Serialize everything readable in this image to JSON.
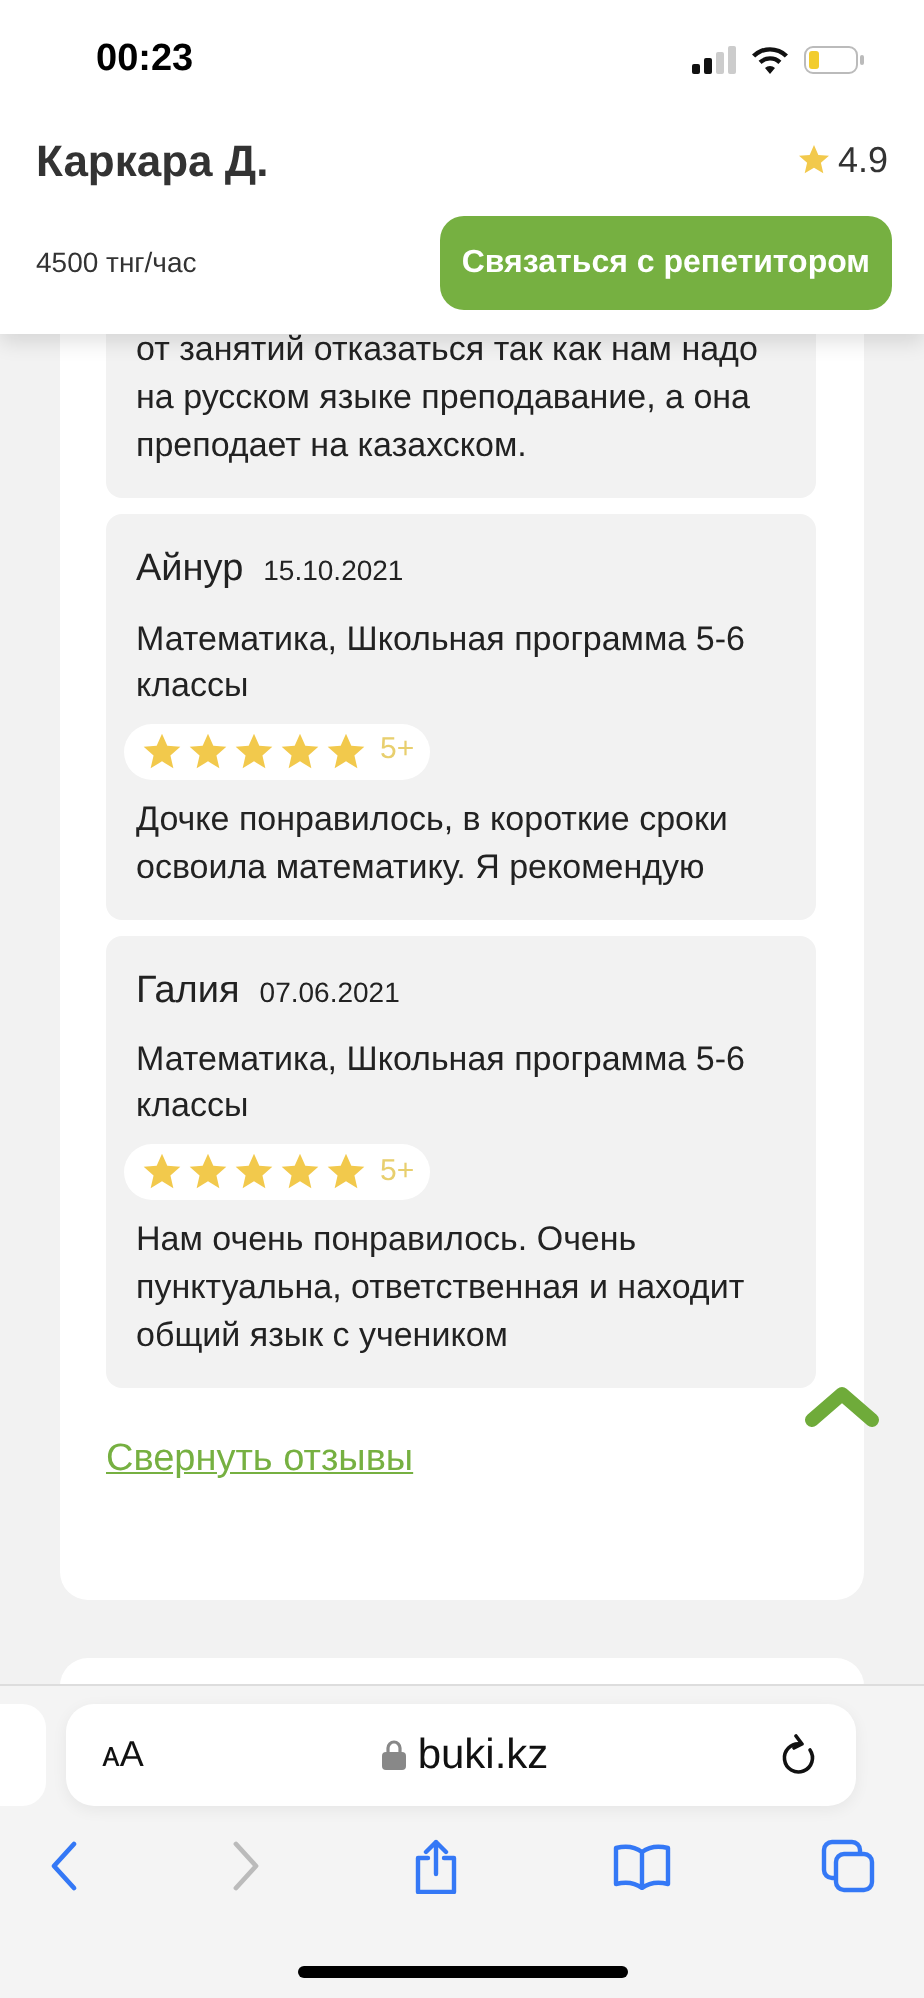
{
  "status_bar": {
    "time": "00:23"
  },
  "tutor": {
    "name": "Каркара Д.",
    "rating": "4.9",
    "price": "4500 тнг/час",
    "contact_button": "Связаться с репетитором"
  },
  "reviews": [
    {
      "text": "от занятий отказаться так как нам надо на русском языке преподавание, а она преподает на казахском."
    },
    {
      "author": "Айнур",
      "date": "15.10.2021",
      "subject": "Математика, Школьная программа 5-6 классы",
      "stars": 5,
      "grade": "5+",
      "text": "Дочке понравилось, в короткие сроки освоила математику. Я рекомендую"
    },
    {
      "author": "Галия",
      "date": "07.06.2021",
      "subject": "Математика, Школьная программа 5-6 классы",
      "stars": 5,
      "grade": "5+",
      "text": "Нам очень понравилось. Очень пунктуальна, ответственная и находит общий язык с учеником"
    }
  ],
  "collapse_link": "Свернуть отзывы",
  "browser": {
    "text_size_button": "ᴀA",
    "url": "buki.kz"
  }
}
